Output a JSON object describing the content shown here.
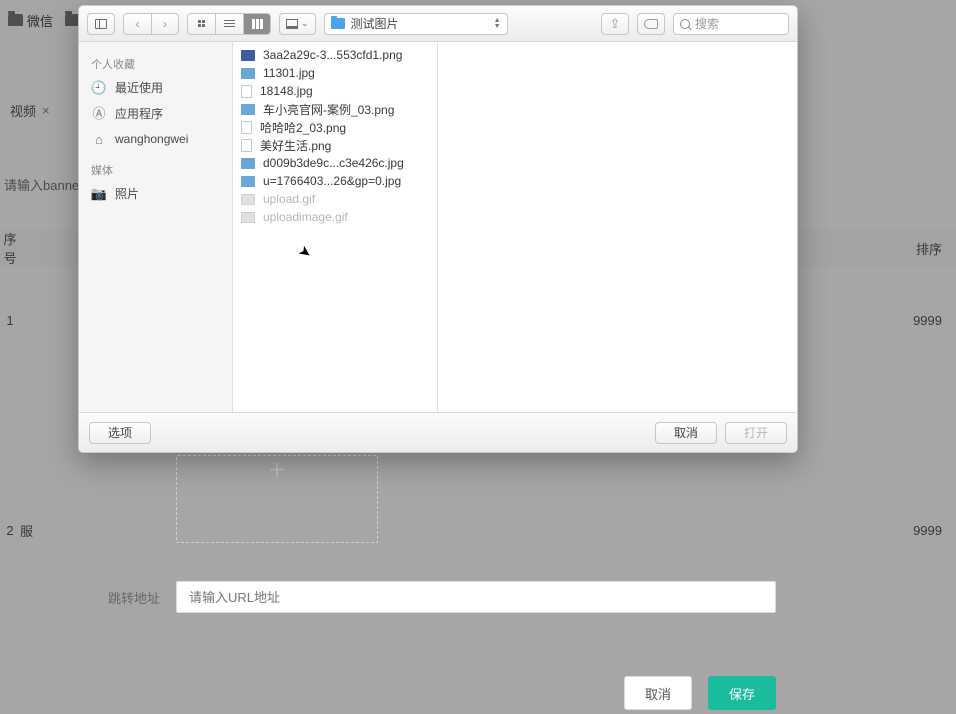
{
  "bg": {
    "topbar_items": [
      "微信"
    ],
    "tab": {
      "label": "视频",
      "close": "×"
    },
    "search_placeholder": "请输入banne",
    "header": {
      "seq": "序号",
      "sort": "排序"
    },
    "rows": [
      {
        "idx": "1",
        "name": "",
        "sort": "9999"
      },
      {
        "idx": "2",
        "name": "服",
        "sort": "9999"
      }
    ]
  },
  "upload_plus": "+",
  "url": {
    "label": "跳转地址",
    "placeholder": "请输入URL地址"
  },
  "mid_buttons": {
    "cancel": "取消",
    "save": "保存"
  },
  "picker": {
    "path_label": "测试图片",
    "search_placeholder": "搜索",
    "gallery_caret": "⌄",
    "sidebar": {
      "section1": "个人收藏",
      "items1": [
        {
          "icon": "🕘",
          "label": "最近使用"
        },
        {
          "icon": "Ⓐ",
          "label": "应用程序"
        },
        {
          "icon": "⌂",
          "label": "wanghongwei"
        }
      ],
      "section2": "媒体",
      "items2": [
        {
          "icon": "📷",
          "label": "照片"
        }
      ]
    },
    "files": [
      {
        "thumb": "b",
        "name": "3aa2a29c-3...553cfd1.png",
        "dim": false
      },
      {
        "thumb": "",
        "name": "11301.jpg",
        "dim": false
      },
      {
        "thumb": "w",
        "name": "18148.jpg",
        "dim": false
      },
      {
        "thumb": "",
        "name": "车小亮官网-案例_03.png",
        "dim": false
      },
      {
        "thumb": "w",
        "name": "哈哈哈2_03.png",
        "dim": false
      },
      {
        "thumb": "w",
        "name": "美好生活.png",
        "dim": false
      },
      {
        "thumb": "",
        "name": "d009b3de9c...c3e426c.jpg",
        "dim": false
      },
      {
        "thumb": "",
        "name": "u=1766403...26&gp=0.jpg",
        "dim": false
      },
      {
        "thumb": "g",
        "name": "upload.gif",
        "dim": true
      },
      {
        "thumb": "g",
        "name": "uploadimage.gif",
        "dim": true
      }
    ],
    "footer": {
      "options": "选项",
      "cancel": "取消",
      "open": "打开"
    }
  }
}
